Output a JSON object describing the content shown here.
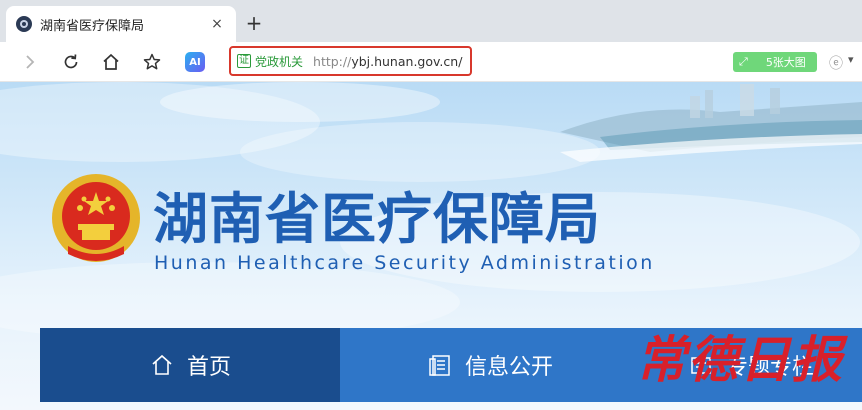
{
  "browser": {
    "tab": {
      "title": "湖南省医疗保障局",
      "close_label": "×"
    },
    "new_tab_label": "+",
    "address": {
      "cert_badge": "证",
      "cert_label": "党政机关",
      "url_protocol": "http://",
      "url_host": "ybj.hunan.gov.cn/"
    },
    "big_image_button": {
      "icon": "expand-icon",
      "label": "5张大图"
    }
  },
  "site": {
    "title": "湖南省医疗保障局",
    "subtitle": "Hunan Healthcare Security Administration",
    "nav": [
      {
        "label": "首页",
        "icon": "home-icon",
        "active": true
      },
      {
        "label": "信息公开",
        "icon": "document-icon",
        "active": false
      },
      {
        "label": "专题专栏",
        "icon": "topic-icon",
        "active": false
      }
    ]
  },
  "watermark": "常德日报",
  "colors": {
    "brand_blue": "#1f5fb3",
    "nav_blue": "#2f76c8",
    "nav_active": "#1a4d8e",
    "address_highlight": "#d8382c",
    "cert_green": "#2a9a3a",
    "watermark_red": "#d8202a"
  }
}
